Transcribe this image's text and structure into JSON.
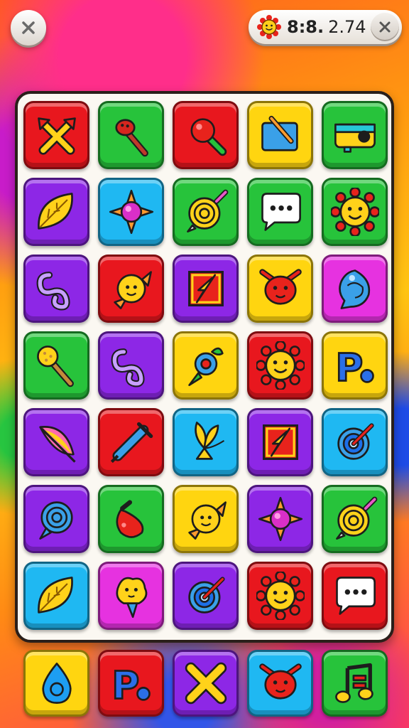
{
  "hud": {
    "level": "8:8.",
    "value": "2.74"
  },
  "board": {
    "rows": [
      [
        {
          "color": "red",
          "icon": "crossed-arrows-icon"
        },
        {
          "color": "green",
          "icon": "torch-icon"
        },
        {
          "color": "red",
          "icon": "magnifier-icon"
        },
        {
          "color": "yellow",
          "icon": "art-tablet-icon"
        },
        {
          "color": "green",
          "icon": "camera-icon"
        }
      ],
      [
        {
          "color": "purple",
          "icon": "leaf-icon"
        },
        {
          "color": "cyan",
          "icon": "flower-icon"
        },
        {
          "color": "green",
          "icon": "spiral-target-icon"
        },
        {
          "color": "green",
          "icon": "speech-bubble-icon"
        },
        {
          "color": "green",
          "icon": "sun-face-icon"
        }
      ],
      [
        {
          "color": "purple",
          "icon": "knot-icon"
        },
        {
          "color": "red",
          "icon": "bird-icon"
        },
        {
          "color": "purple",
          "icon": "bolt-frame-icon"
        },
        {
          "color": "yellow",
          "icon": "devil-face-icon"
        },
        {
          "color": "pink",
          "icon": "shell-icon"
        }
      ],
      [
        {
          "color": "green",
          "icon": "wand-icon"
        },
        {
          "color": "purple",
          "icon": "knot-icon"
        },
        {
          "color": "yellow",
          "icon": "blossom-icon"
        },
        {
          "color": "red",
          "icon": "sun-face-icon"
        },
        {
          "color": "yellow",
          "icon": "letter-p-icon"
        }
      ],
      [
        {
          "color": "purple",
          "icon": "feather-icon"
        },
        {
          "color": "red",
          "icon": "syringe-icon"
        },
        {
          "color": "cyan",
          "icon": "plant-icon"
        },
        {
          "color": "purple",
          "icon": "bolt-frame-icon"
        },
        {
          "color": "cyan",
          "icon": "target-icon"
        }
      ],
      [
        {
          "color": "purple",
          "icon": "spiral-icon"
        },
        {
          "color": "green",
          "icon": "pin-icon"
        },
        {
          "color": "yellow",
          "icon": "bird-icon"
        },
        {
          "color": "purple",
          "icon": "flower-icon"
        },
        {
          "color": "green",
          "icon": "spiral-target-icon"
        }
      ],
      [
        {
          "color": "cyan",
          "icon": "leaf-icon"
        },
        {
          "color": "pink",
          "icon": "ice-cream-icon"
        },
        {
          "color": "purple",
          "icon": "target-icon"
        },
        {
          "color": "red",
          "icon": "sun-face-icon"
        },
        {
          "color": "red",
          "icon": "speech-bubble-icon"
        }
      ]
    ]
  },
  "tray": [
    {
      "color": "yellow",
      "icon": "drop-icon"
    },
    {
      "color": "red",
      "icon": "letter-p-icon"
    },
    {
      "color": "purple",
      "icon": "x-mark-icon"
    },
    {
      "color": "cyan",
      "icon": "devil-face-icon"
    },
    {
      "color": "green",
      "icon": "music-note-icon"
    }
  ]
}
